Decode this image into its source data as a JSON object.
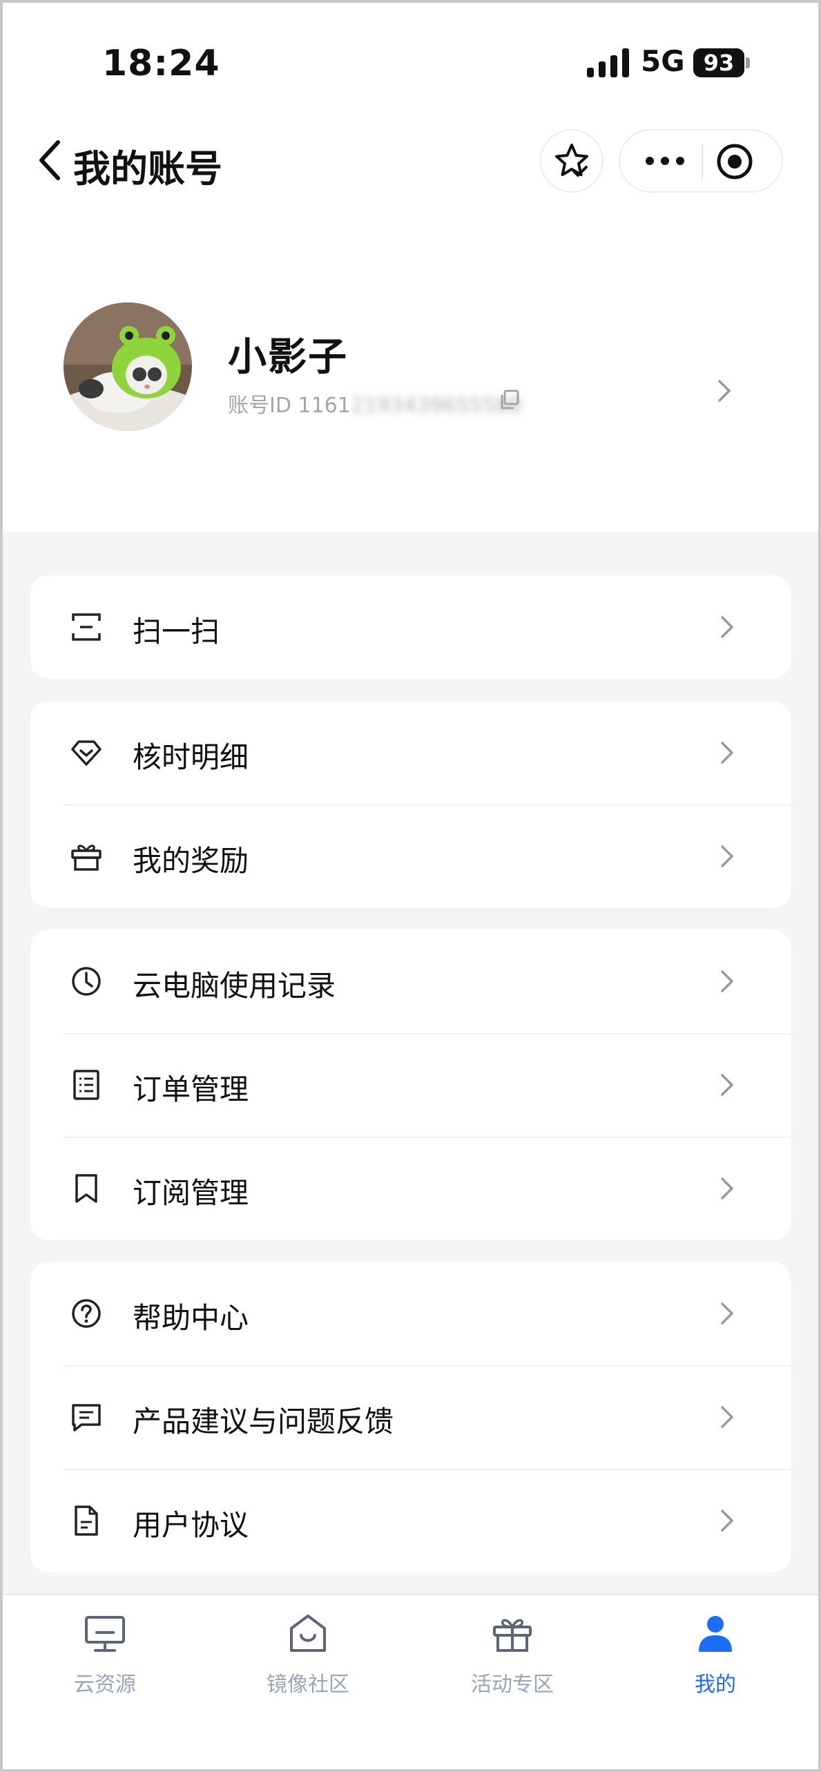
{
  "status_bar": {
    "time": "18:24",
    "network": "5G",
    "battery": "93"
  },
  "nav": {
    "title": "我的账号"
  },
  "profile": {
    "name": "小影子",
    "id_label": "账号ID",
    "id_visible": "1161",
    "id_blurred": "2193439655588"
  },
  "menu": {
    "group1": [
      {
        "label": "扫一扫",
        "icon": "scan-icon"
      }
    ],
    "group2": [
      {
        "label": "核时明细",
        "icon": "diamond-icon"
      },
      {
        "label": "我的奖励",
        "icon": "gift-icon"
      }
    ],
    "group3": [
      {
        "label": "云电脑使用记录",
        "icon": "clock-icon"
      },
      {
        "label": "订单管理",
        "icon": "list-icon"
      },
      {
        "label": "订阅管理",
        "icon": "bookmark-icon"
      }
    ],
    "group4": [
      {
        "label": "帮助中心",
        "icon": "help-icon"
      },
      {
        "label": "产品建议与问题反馈",
        "icon": "feedback-icon"
      },
      {
        "label": "用户协议",
        "icon": "document-icon"
      }
    ]
  },
  "tabs": [
    {
      "label": "云资源",
      "icon": "monitor-icon",
      "active": false
    },
    {
      "label": "镜像社区",
      "icon": "community-icon",
      "active": false
    },
    {
      "label": "活动专区",
      "icon": "gift-icon",
      "active": false
    },
    {
      "label": "我的",
      "icon": "person-icon",
      "active": true
    }
  ],
  "colors": {
    "accent": "#1b6ef3",
    "inactive_tab": "#9aa5b8",
    "page_bg": "#f5f5f5",
    "card_bg": "#ffffff"
  }
}
